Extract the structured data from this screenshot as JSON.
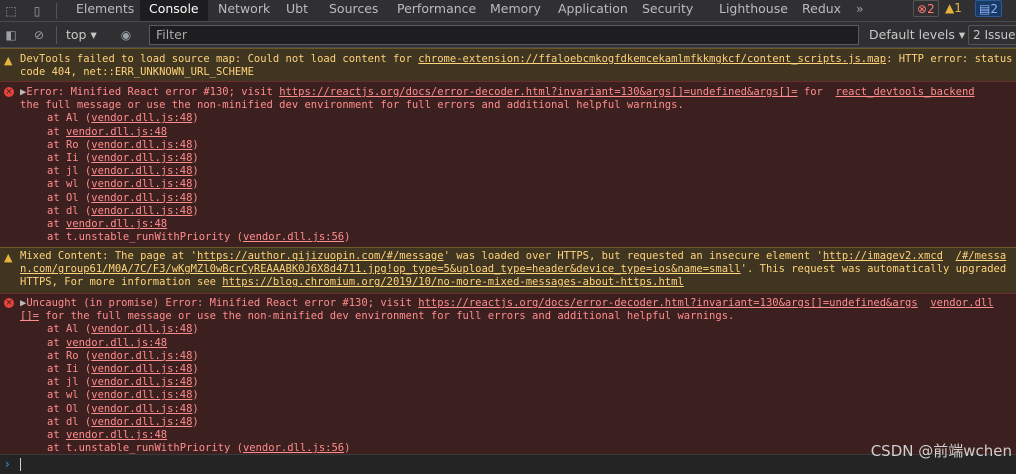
{
  "devtools": {
    "tabs": [
      "Elements",
      "Console",
      "Network",
      "Ubt",
      "Sources",
      "Performance",
      "Memory",
      "Application",
      "Security",
      "Lighthouse",
      "Redux"
    ],
    "more": "»",
    "error_count": "2",
    "warning_count": "1",
    "message_count": "2"
  },
  "toolbar": {
    "context": "top",
    "filter_placeholder": "Filter",
    "levels": "Default levels",
    "issues": "2 Issue"
  },
  "messages": [
    {
      "level": "warning",
      "lines": [
        [
          {
            "t": "DevTools failed to load source map: Could not load content for "
          },
          {
            "t": "chrome-extension://ffaloebcmkogfdkemcekamlmfkkmgkcf/content_scripts.js.map",
            "u": true
          },
          {
            "t": ": HTTP error: status"
          }
        ],
        [
          {
            "t": "code 404, net::ERR_UNKNOWN_URL_SCHEME"
          }
        ]
      ]
    },
    {
      "level": "error",
      "lines": [
        [
          {
            "t": "▶",
            "tri": true
          },
          {
            "t": "Error: Minified React error #130; visit "
          },
          {
            "t": "https://reactjs.org/docs/error-decoder.html?invariant=130&args[]=undefined&args[]=",
            "u": true
          },
          {
            "t": " for  "
          },
          {
            "t": "react_devtools_backend",
            "u": true
          }
        ],
        [
          {
            "t": "the full message or use the non-minified dev environment for full errors and additional helpful warnings."
          }
        ]
      ],
      "stack": [
        [
          "at Al (",
          "vendor.dll.js:48",
          ")"
        ],
        [
          "at ",
          "vendor.dll.js:48",
          ""
        ],
        [
          "at Ro (",
          "vendor.dll.js:48",
          ")"
        ],
        [
          "at Ii (",
          "vendor.dll.js:48",
          ")"
        ],
        [
          "at jl (",
          "vendor.dll.js:48",
          ")"
        ],
        [
          "at wl (",
          "vendor.dll.js:48",
          ")"
        ],
        [
          "at Ol (",
          "vendor.dll.js:48",
          ")"
        ],
        [
          "at dl (",
          "vendor.dll.js:48",
          ")"
        ],
        [
          "at ",
          "vendor.dll.js:48",
          ""
        ],
        [
          "at t.unstable_runWithPriority (",
          "vendor.dll.js:56",
          ")"
        ]
      ]
    },
    {
      "level": "warning",
      "lines": [
        [
          {
            "t": "Mixed Content: The page at '"
          },
          {
            "t": "https://author.qijizuopin.com/#/message",
            "u": true
          },
          {
            "t": "' was loaded over HTTPS, but requested an insecure element '"
          },
          {
            "t": "http://imagev2.xmcd",
            "u": true
          },
          {
            "t": "  "
          },
          {
            "t": "/#/messa",
            "u": true
          }
        ],
        [
          {
            "t": "n.com/group61/M0A/7C/F3/wKgMZl0wBcrCyREAAABK0J6X8d4711.jpg!op_type=5&upload_type=header&device_type=ios&name=small",
            "u": true
          },
          {
            "t": "'. This request was automatically upgraded"
          }
        ],
        [
          {
            "t": "HTTPS, For more information see "
          },
          {
            "t": "https://blog.chromium.org/2019/10/no-more-mixed-messages-about-https.html",
            "u": true
          }
        ]
      ]
    },
    {
      "level": "error",
      "lines": [
        [
          {
            "t": "▶",
            "tri": true
          },
          {
            "t": "Uncaught (in promise) Error: Minified React error #130; visit "
          },
          {
            "t": "https://reactjs.org/docs/error-decoder.html?invariant=130&args[]=undefined&args",
            "u": true
          },
          {
            "t": "  "
          },
          {
            "t": "vendor.dll",
            "u": true
          }
        ],
        [
          {
            "t": "[]=",
            "u": true
          },
          {
            "t": " for the full message or use the non-minified dev environment for full errors and additional helpful warnings."
          }
        ]
      ],
      "stack": [
        [
          "at Al (",
          "vendor.dll.js:48",
          ")"
        ],
        [
          "at ",
          "vendor.dll.js:48",
          ""
        ],
        [
          "at Ro (",
          "vendor.dll.js:48",
          ")"
        ],
        [
          "at Ii (",
          "vendor.dll.js:48",
          ")"
        ],
        [
          "at jl (",
          "vendor.dll.js:48",
          ")"
        ],
        [
          "at wl (",
          "vendor.dll.js:48",
          ")"
        ],
        [
          "at Ol (",
          "vendor.dll.js:48",
          ")"
        ],
        [
          "at dl (",
          "vendor.dll.js:48",
          ")"
        ],
        [
          "at ",
          "vendor.dll.js:48",
          ""
        ],
        [
          "at t.unstable_runWithPriority (",
          "vendor.dll.js:56",
          ")"
        ]
      ]
    }
  ],
  "watermark": "CSDN @前端wchen"
}
